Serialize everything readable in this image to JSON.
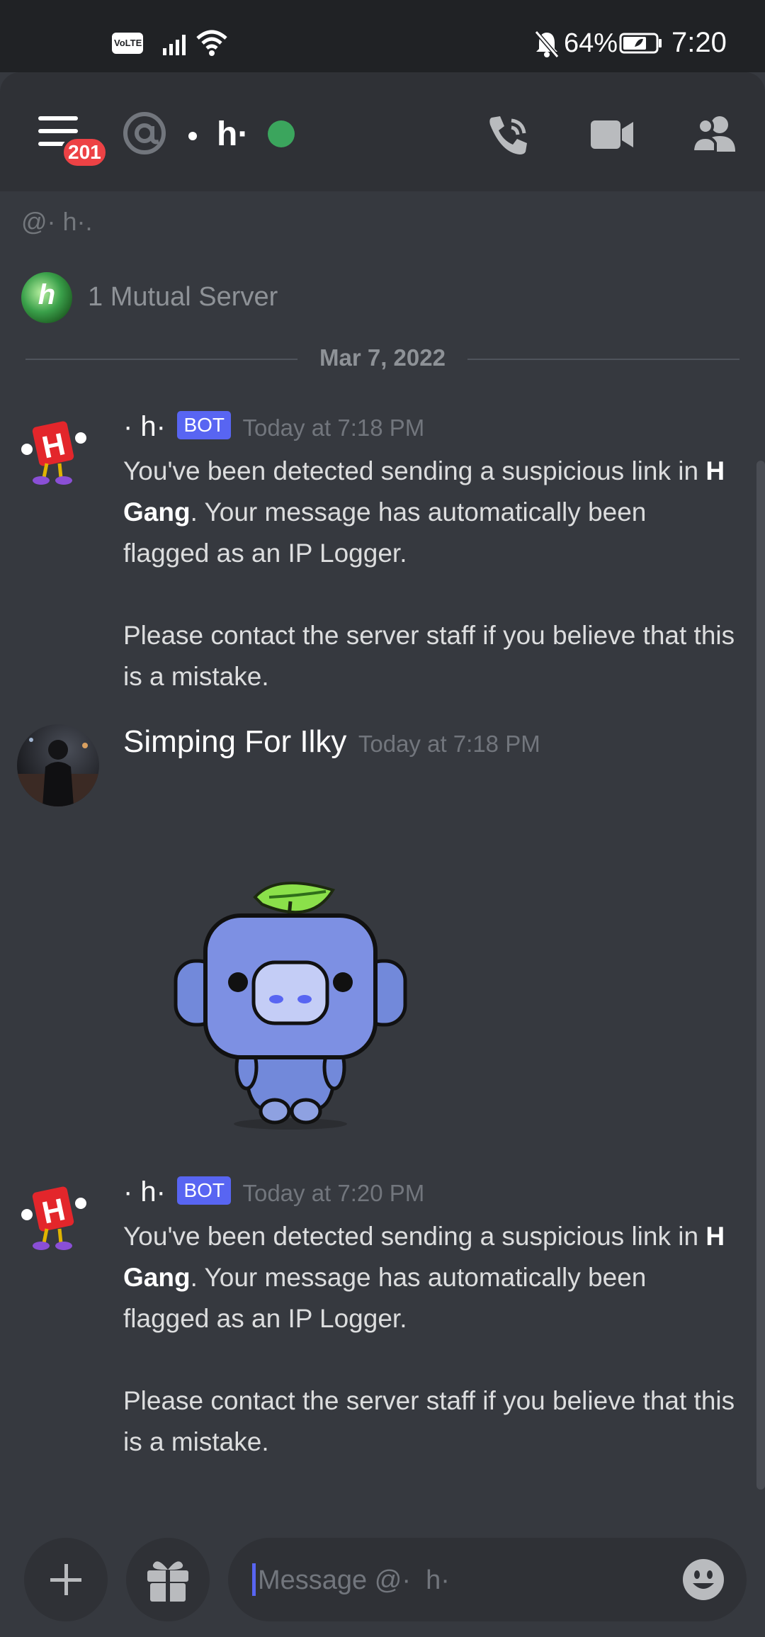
{
  "status_bar": {
    "volte": "VoLTE",
    "battery_percent": "64%",
    "time": "7:20"
  },
  "header": {
    "unread_badge": "201",
    "channel_name": "h·",
    "online_status": "online"
  },
  "chat": {
    "profile_handle": "@· h·.",
    "mutual_servers": "1 Mutual Server",
    "date_divider": "Mar 7, 2022",
    "messages": [
      {
        "author": "· h·",
        "bot_tag": "BOT",
        "timestamp": "Today at 7:18 PM",
        "line1_pre": "You've been detected sending a suspicious link in",
        "bold": "H Gang",
        "line1_post": ". Your message has automatically been flagged as an IP Logger.",
        "line2": "Please contact the server staff if you believe that this is a mistake."
      },
      {
        "author": "Simping For Ilky",
        "timestamp": "Today at 7:18 PM",
        "sticker": "wumpus-leaf-sticker"
      },
      {
        "author": "· h·",
        "bot_tag": "BOT",
        "timestamp": "Today at 7:20 PM",
        "line1_pre": "You've been detected sending a suspicious link in",
        "bold": "H Gang",
        "line1_post": ". Your message has automatically been flagged as an IP Logger.",
        "line2": "Please contact the server staff if you believe that this is a mistake."
      }
    ]
  },
  "input": {
    "placeholder": "Message @·  h·"
  },
  "colors": {
    "background": "#36393f",
    "header": "#2f3136",
    "bot_tag": "#5865f2",
    "badge": "#ed4245",
    "online": "#3ba55d"
  }
}
